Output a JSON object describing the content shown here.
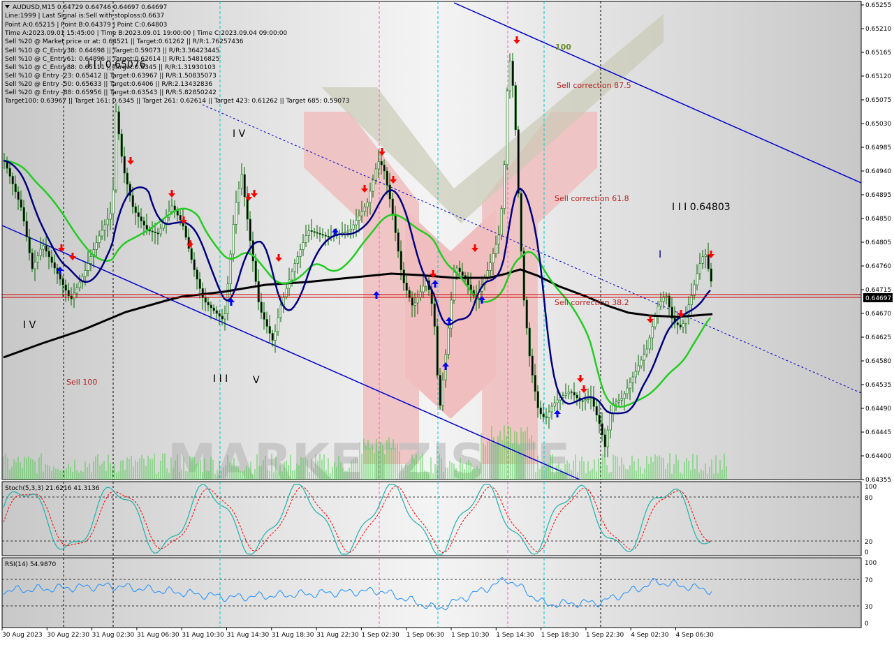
{
  "window": {
    "symbol_line": "AUDUSD,M15  0.64729 0.64746 0.64697 0.64697",
    "info_lines": [
      "Line:1999 | Last Signal is:Sell with stoploss:0.6637",
      "Point A:0.65215 | Point B:0.64379 | Point C:0.64803",
      "Time A:2023.09.01 15:45:00 | Time B:2023.09.01 19:00:00 | Time C:2023.09.04 09:00:00",
      "Sell %20 @ Market price or at: 0.64521 || Target:0.61262 || R/R:1.76257436",
      "Sell %10 @ C_Entry38: 0.64698 || Target:0.59073 || R/R:3.36423445",
      "Sell %10 @ C_Entry61: 0.64896 || Target:0.62614 || R/R:1.54816825",
      "Sell %10 @ C_Entry88: 0.65111 || Target:0.6345 || R/R:1.31930103",
      "Sell %10 @ Entry -23: 0.65412 || Target:0.63967 || R/R:1.50835073",
      "Sell %20 @ Entry -50: 0.65633 || Target:0.6406 || R/R:2.13432836",
      "Sell %20 @ Entry -88: 0.65956 || Target:0.63543 || R/R:5.82850242",
      "Target100: 0.63967 || Target 161: 0.6345 || Target 261: 0.62614 || Target 423: 0.61262 || Target 685: 0.59073"
    ]
  },
  "price_axis": {
    "labels": [
      "0.65255",
      "0.65210",
      "0.65165",
      "0.65120",
      "0.65075",
      "0.65030",
      "0.64985",
      "0.64940",
      "0.64895",
      "0.64850",
      "0.64805",
      "0.64760",
      "0.64715",
      "0.64670",
      "0.64625",
      "0.64580",
      "0.64535",
      "0.64490",
      "0.64445",
      "0.64400",
      "0.64355"
    ],
    "current_price": "0.64697"
  },
  "time_axis": {
    "labels": [
      "30 Aug 2023",
      "30 Aug 22:30",
      "31 Aug 02:30",
      "31 Aug 06:30",
      "31 Aug 10:30",
      "31 Aug 14:30",
      "31 Aug 18:30",
      "31 Aug 22:30",
      "1 Sep 02:30",
      "1 Sep 06:30",
      "1 Sep 10:30",
      "1 Sep 14:30",
      "1 Sep 18:30",
      "1 Sep 22:30",
      "4 Sep 02:30",
      "4 Sep 06:30"
    ]
  },
  "annotations": {
    "wave_iii_top": "I I I 0.65076",
    "wave_iv_mid": "I V",
    "wave_iv_left": "I V",
    "wave_iii_low": "I I I",
    "wave_v": "V",
    "wave_i": "I",
    "wave_iii_right": "I I I 0.64803",
    "sell_100": "Sell 100",
    "level_100": "100",
    "sell_875": "Sell correction 87.5",
    "sell_618": "Sell correction 61.8",
    "sell_382": "Sell correction 38.2"
  },
  "stoch": {
    "title": "Stoch(5,3,3) 21.6216 41.3136",
    "levels": [
      "100",
      "80",
      "20",
      "0"
    ]
  },
  "rsi": {
    "title": "RSI(14) 54.9870",
    "levels": [
      "100",
      "70",
      "30",
      "0"
    ]
  },
  "watermark": {
    "text": "MARKETZISITE"
  },
  "colors": {
    "ema_fast": "#000080",
    "ema_mid": "#22cc22",
    "ema_slow": "#000000",
    "channel": "#0000cc",
    "sell_arrow": "#ff0000",
    "buy_arrow": "#0000ff",
    "price_line": "#cc0000",
    "stoch_main": "#20b2aa",
    "stoch_signal": "#ff0000",
    "rsi_line": "#1e90ff"
  }
}
